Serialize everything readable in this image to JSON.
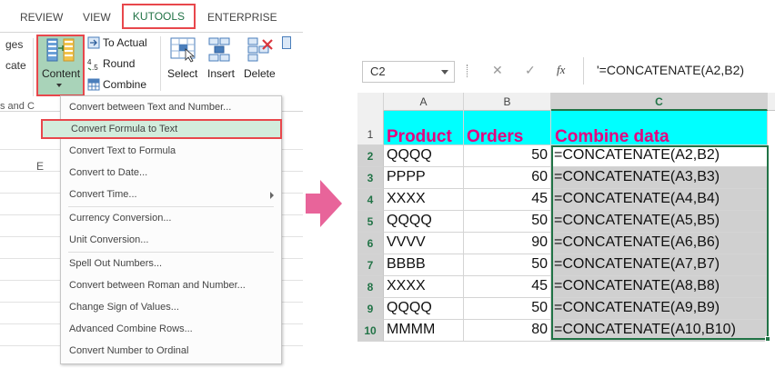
{
  "ribbon": {
    "tabs": [
      "REVIEW",
      "VIEW",
      "KUTOOLS",
      "ENTERPRISE"
    ],
    "active_tab": "KUTOOLS",
    "left_partial_labels": [
      "ges",
      "cate",
      "s and C"
    ],
    "content_label": "Content",
    "to_actual_label": "To Actual",
    "round_label": "Round",
    "combine_label": "Combine",
    "select_label": "Select",
    "insert_label": "Insert",
    "delete_label": "Delete",
    "grid_partial_label": "E"
  },
  "menu": {
    "items": [
      "Convert between Text and Number...",
      "Convert Formula to Text",
      "Convert Text to Formula",
      "Convert to Date...",
      "Convert Time...",
      "Currency Conversion...",
      "Unit Conversion...",
      "Spell Out Numbers...",
      "Convert between Roman and Number...",
      "Change Sign of Values...",
      "Advanced Combine Rows...",
      "Convert Number to Ordinal"
    ],
    "highlighted_index": 1
  },
  "formula_bar": {
    "name_box": "C2",
    "fx_label": "fx",
    "formula": "'=CONCATENATE(A2,B2)"
  },
  "sheet": {
    "columns": [
      "A",
      "B",
      "C"
    ],
    "row_numbers": [
      "1",
      "2",
      "3",
      "4",
      "5",
      "6",
      "7",
      "8",
      "9",
      "10"
    ],
    "headers": [
      "Product",
      "Orders",
      "Combine data"
    ],
    "rows": [
      [
        "QQQQ",
        "50",
        "=CONCATENATE(A2,B2)"
      ],
      [
        "PPPP",
        "60",
        "=CONCATENATE(A3,B3)"
      ],
      [
        "XXXX",
        "45",
        "=CONCATENATE(A4,B4)"
      ],
      [
        "QQQQ",
        "50",
        "=CONCATENATE(A5,B5)"
      ],
      [
        "VVVV",
        "90",
        "=CONCATENATE(A6,B6)"
      ],
      [
        "BBBB",
        "50",
        "=CONCATENATE(A7,B7)"
      ],
      [
        "XXXX",
        "45",
        "=CONCATENATE(A8,B8)"
      ],
      [
        "QQQQ",
        "50",
        "=CONCATENATE(A9,B9)"
      ],
      [
        "MMMM",
        "80",
        "=CONCATENATE(A10,B10)"
      ]
    ],
    "selected_column": "C"
  },
  "colors": {
    "header_text": "#e6007e",
    "header_fill": "#00ffff",
    "selection_gray": "#d0d0d0",
    "excel_green": "#217346",
    "highlight_border": "#e8474c",
    "arrow_pink": "#e8649a"
  },
  "icons": [
    "content-icon",
    "to-actual-icon",
    "round-icon",
    "combine-icon",
    "select-icon",
    "insert-icon",
    "delete-icon",
    "arrow-right-icon",
    "cancel-icon",
    "check-icon",
    "dropdown-icon",
    "submenu-arrow-icon"
  ]
}
